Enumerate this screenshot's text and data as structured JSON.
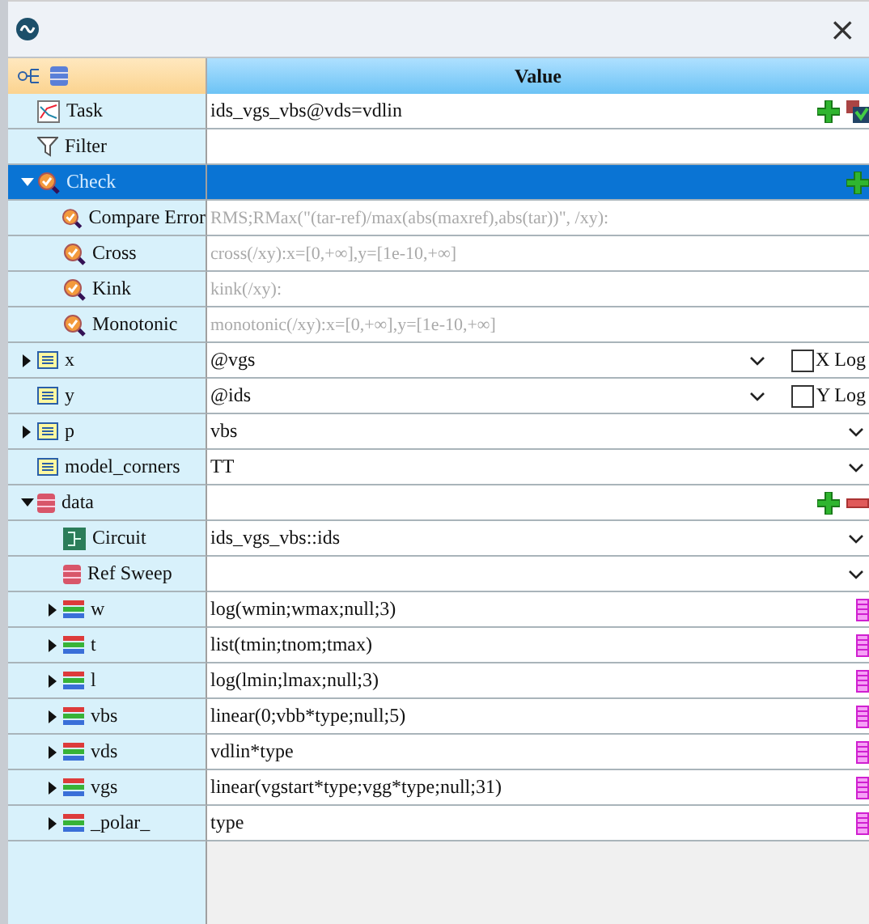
{
  "window": {
    "close": "×"
  },
  "header": {
    "value_title": "Value"
  },
  "rows": [
    {
      "label": "Task",
      "kind": "task",
      "value": "ids_vgs_vbs@vds=vdlin",
      "actions": [
        {
          "kind": "add"
        },
        {
          "kind": "edit"
        }
      ]
    },
    {
      "label": "Filter",
      "kind": "filter"
    },
    {
      "label": "Check",
      "kind": "check",
      "selected": true,
      "expanded": true,
      "actions": [
        {
          "kind": "add"
        }
      ],
      "children": [
        {
          "label": "Compare Error",
          "kind": "check",
          "placeholder": "RMS;RMax(\"(tar-ref)/max(abs(maxref),abs(tar))\", /xy):"
        },
        {
          "label": "Cross",
          "kind": "check",
          "placeholder": "cross(/xy):x=[0,+∞],y=[1e-10,+∞]"
        },
        {
          "label": "Kink",
          "kind": "check",
          "placeholder": "kink(/xy):"
        },
        {
          "label": "Monotonic",
          "kind": "check",
          "placeholder": "monotonic(/xy):x=[0,+∞],y=[1e-10,+∞]"
        }
      ]
    },
    {
      "label": "x",
      "kind": "var",
      "expanded": false,
      "value": "@vgs",
      "dropdown": true,
      "checkbox": {
        "label": "X Log",
        "checked": false
      }
    },
    {
      "label": "y",
      "kind": "var",
      "value": "@ids",
      "dropdown": true,
      "checkbox": {
        "label": "Y Log",
        "checked": false
      }
    },
    {
      "label": "p",
      "kind": "var",
      "expanded": false,
      "value": "vbs",
      "dropdown": true
    },
    {
      "label": "model_corners",
      "kind": "var",
      "value": "TT",
      "dropdown": true
    },
    {
      "label": "data",
      "kind": "db",
      "expanded": true,
      "actions": [
        {
          "kind": "add"
        },
        {
          "kind": "remove"
        }
      ],
      "children": [
        {
          "label": "Circuit",
          "kind": "circuit",
          "value": "ids_vgs_vbs::ids",
          "dropdown": true
        },
        {
          "label": "Ref Sweep",
          "kind": "db",
          "dropdown": true
        },
        {
          "label": "w",
          "kind": "sweep",
          "expanded": false,
          "value": "log(wmin;wmax;null;3)",
          "actions": [
            {
              "kind": "list"
            }
          ]
        },
        {
          "label": "t",
          "kind": "sweep",
          "expanded": false,
          "value": "list(tmin;tnom;tmax)",
          "actions": [
            {
              "kind": "list"
            }
          ]
        },
        {
          "label": "l",
          "kind": "sweep",
          "expanded": false,
          "value": "log(lmin;lmax;null;3)",
          "actions": [
            {
              "kind": "list"
            }
          ]
        },
        {
          "label": "vbs",
          "kind": "sweep",
          "expanded": false,
          "value": "linear(0;vbb*type;null;5)",
          "actions": [
            {
              "kind": "list"
            }
          ]
        },
        {
          "label": "vds",
          "kind": "sweep",
          "expanded": false,
          "value": "vdlin*type",
          "actions": [
            {
              "kind": "list"
            }
          ]
        },
        {
          "label": "vgs",
          "kind": "sweep",
          "expanded": false,
          "value": "linear(vgstart*type;vgg*type;null;31)",
          "actions": [
            {
              "kind": "list"
            }
          ]
        },
        {
          "label": "_polar_",
          "kind": "sweep",
          "expanded": false,
          "value": "type",
          "actions": [
            {
              "kind": "list"
            }
          ]
        }
      ]
    }
  ]
}
